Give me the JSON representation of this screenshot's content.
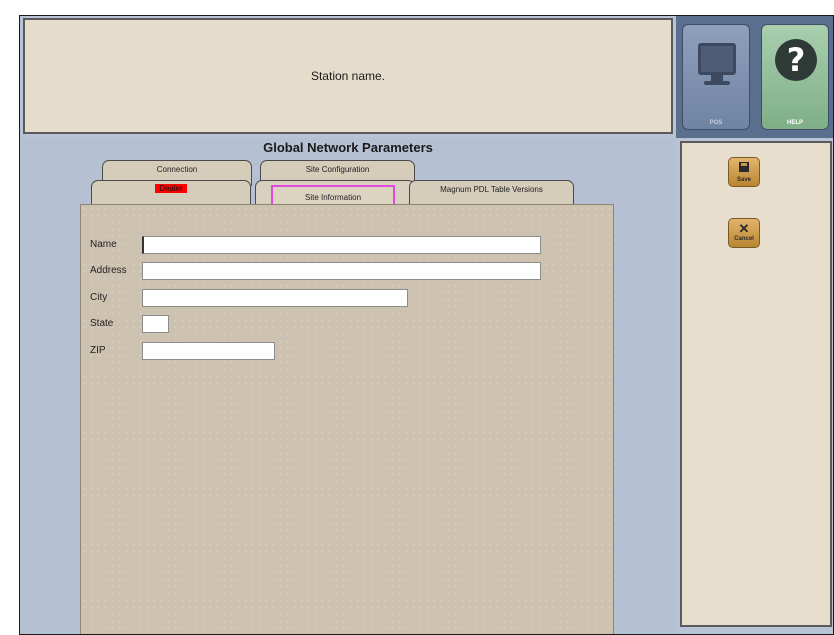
{
  "banner": {
    "station_text": "Station name."
  },
  "topbar": {
    "pos_label": "POS",
    "help_label": "HELP",
    "help_glyph": "?"
  },
  "main": {
    "title": "Global Network Parameters",
    "tabs": {
      "connection": "Connection",
      "site_configuration": "Site Configuration",
      "dealer": "Dealer",
      "site_information": "Site Information",
      "pdl_table_versions": "Magnum PDL Table Versions"
    },
    "active_tab": "Site Information",
    "form": {
      "name_label": "Name",
      "name_value": "",
      "address_label": "Address",
      "address_value": "",
      "city_label": "City",
      "city_value": "",
      "state_label": "State",
      "state_value": "",
      "zip_label": "ZIP",
      "zip_value": ""
    }
  },
  "sidepanel": {
    "save_label": "Save",
    "cancel_label": "Cancel",
    "cancel_glyph": "✕"
  },
  "icons": [
    "monitor-icon",
    "help-question-icon",
    "floppy-disk-icon",
    "close-x-icon"
  ],
  "colors": {
    "dealer_tab_highlight": "#ff0000",
    "active_tab_outline": "#e048e0",
    "action_button": "#d6a455"
  }
}
